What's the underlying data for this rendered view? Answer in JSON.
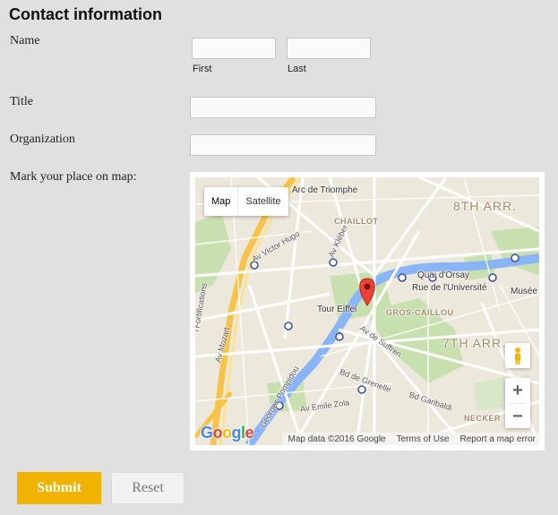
{
  "form": {
    "heading": "Contact information",
    "name_label": "Name",
    "first_sublabel": "First",
    "last_sublabel": "Last",
    "first_value": "",
    "last_value": "",
    "title_label": "Title",
    "title_value": "",
    "organization_label": "Organization",
    "organization_value": "",
    "map_label": "Mark your place on map:"
  },
  "map": {
    "type_options": [
      "Map",
      "Satellite"
    ],
    "selected_type": "Map",
    "zoom_in": "+",
    "zoom_out": "−",
    "labels": {
      "arc": "Arc de Triomphe",
      "arr8": "8TH ARR.",
      "chaillot": "CHAILLOT",
      "victor_hugo": "Av Victor Hugo",
      "kleber": "Av Kléber",
      "quai_orsay": "Quai d'Orsay",
      "universite": "Rue de l'Université",
      "musee": "Musée",
      "tour_eiffel": "Tour Eiffel",
      "gros_caillou": "GROS-CAILLOU",
      "suffren": "Av de Suffren",
      "arr7": "7TH ARR.",
      "mozart": "Av Mozart",
      "fortifications": "l'Fortifications",
      "grenelle": "Bd de Grenelle",
      "garibaldi": "Bd Garibaldi",
      "pompidou": "Georges Pompidou",
      "zola": "Av Emile Zola",
      "necker": "NECKER"
    },
    "google_letters": [
      "G",
      "o",
      "o",
      "g",
      "l",
      "e"
    ],
    "attribution": {
      "data": "Map data ©2016 Google",
      "terms": "Terms of Use",
      "report": "Report a map error"
    }
  },
  "buttons": {
    "submit": "Submit",
    "reset": "Reset"
  },
  "colors": {
    "accent": "#f0b400",
    "background": "#e0e0e0",
    "marker": "#ea4335",
    "river": "#8ab4f8"
  }
}
